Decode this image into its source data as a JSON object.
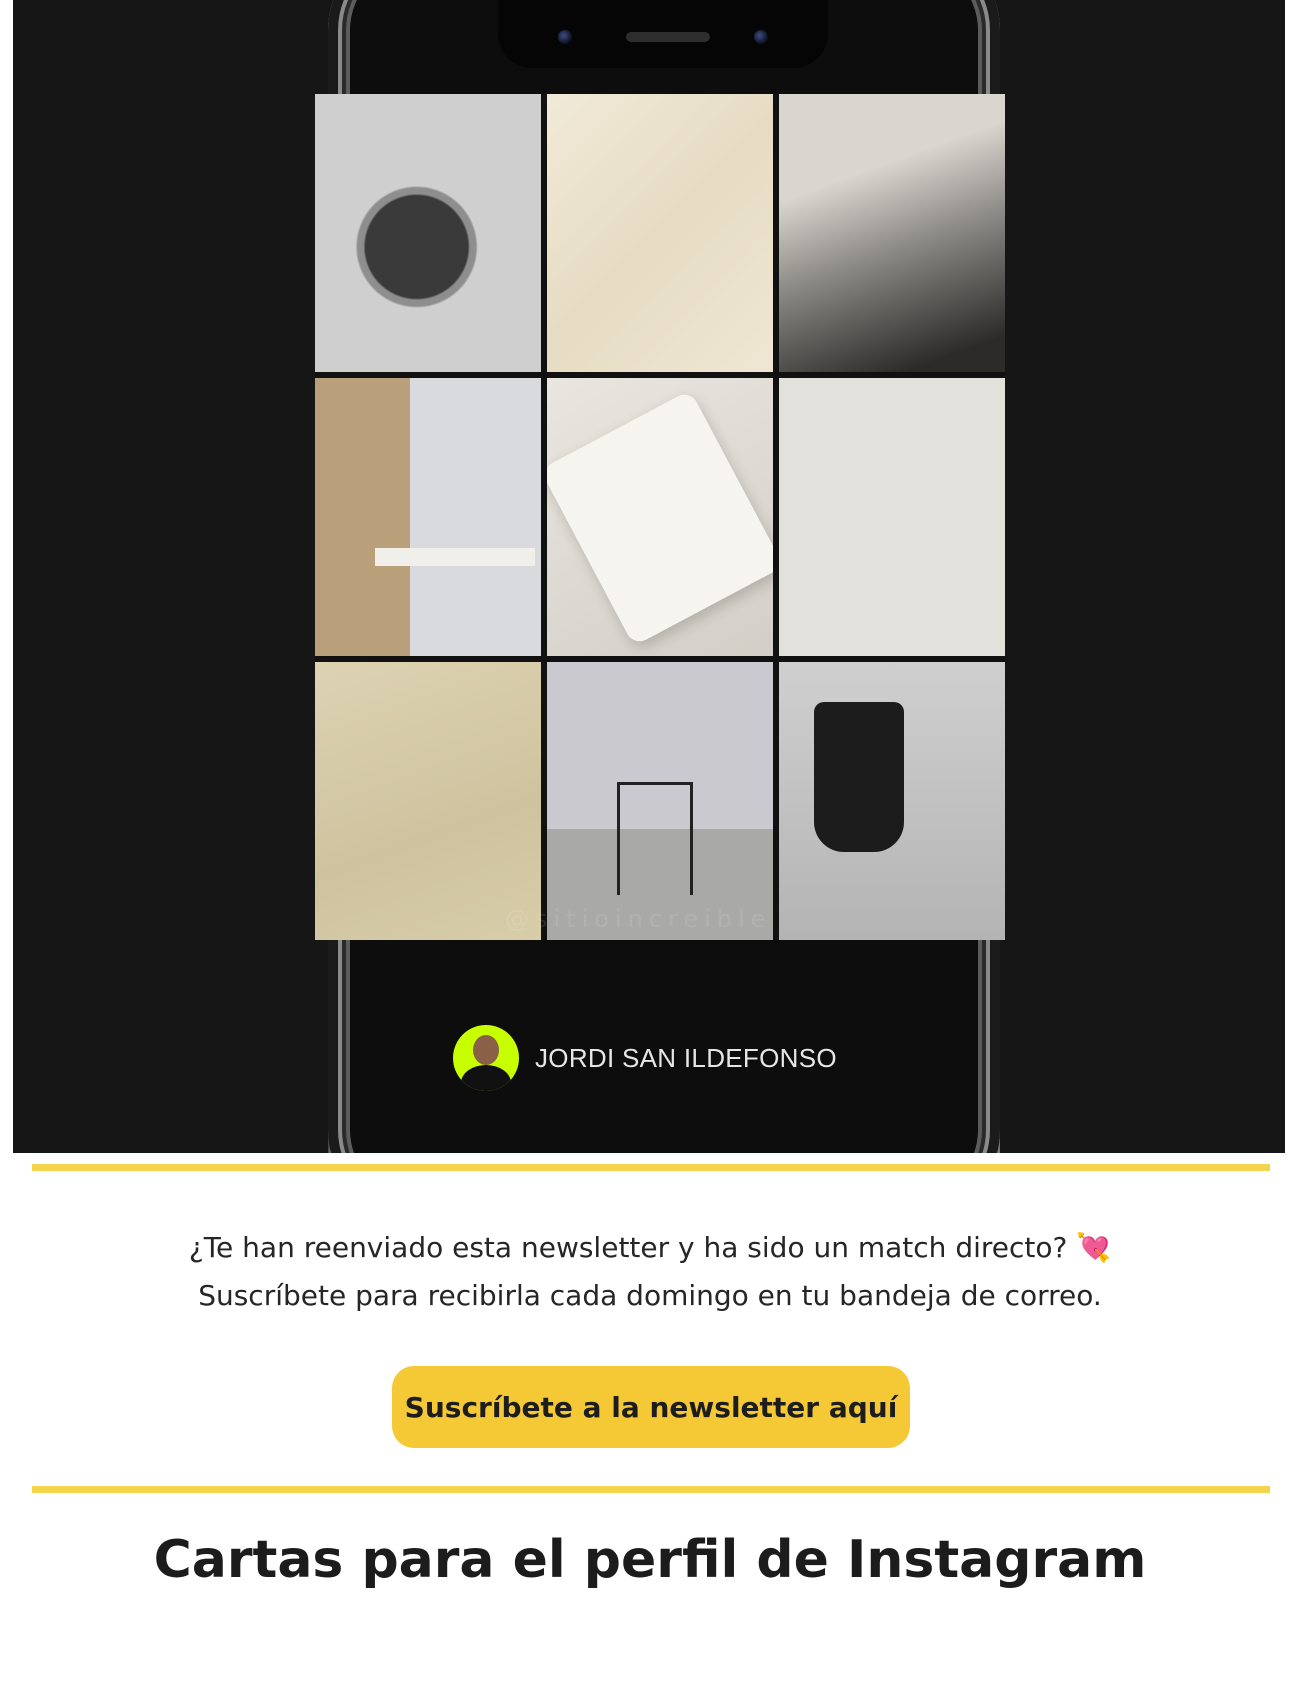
{
  "hero": {
    "watermark": "@sitioincreible",
    "author_name": "JORDI SAN ILDEFONSO",
    "grid_tiles": [
      "bottle-photo",
      "paper-texture",
      "hands-photo",
      "table-chairs-photo",
      "cassette-photo",
      "blank-tile",
      "paper-texture",
      "chair-photo",
      "boots-photo"
    ]
  },
  "forward": {
    "line1": "¿Te han reenviado esta newsletter y ha sido un match directo?",
    "heart_icon": "💘",
    "line2": "Suscríbete para recibirla cada domingo en tu bandeja de correo."
  },
  "cta": {
    "label": "Suscríbete a la newsletter aquí"
  },
  "section": {
    "title": "Cartas para el perfil de Instagram"
  },
  "colors": {
    "accent": "#f5c935",
    "divider": "#f5d44d",
    "hero_bg": "#161616"
  }
}
